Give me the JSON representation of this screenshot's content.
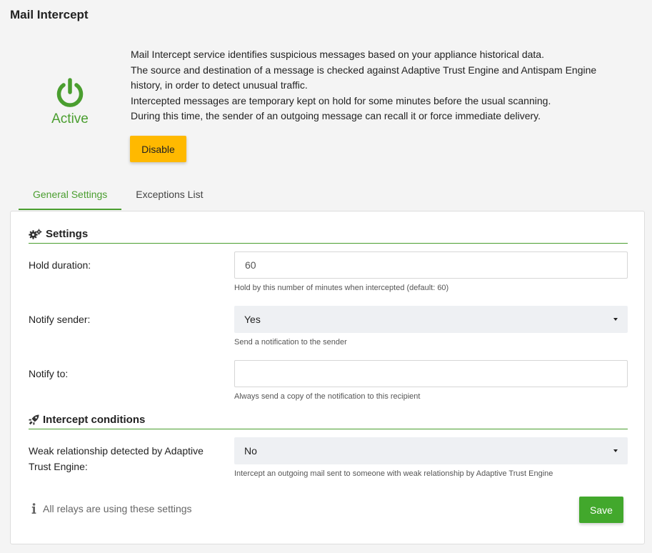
{
  "page": {
    "title": "Mail Intercept"
  },
  "status": {
    "label": "Active",
    "icon": "power-icon",
    "color": "#4a9e2f"
  },
  "description": {
    "lines": [
      "Mail Intercept service identifies suspicious messages based on your appliance historical data.",
      "The source and destination of a message is checked against Adaptive Trust Engine and Antispam Engine",
      "history, in order to detect unusual traffic.",
      "Intercepted messages are temporary kept on hold for some minutes before the usual scanning.",
      "During this time, the sender of an outgoing message can recall it or force immediate delivery."
    ]
  },
  "actions": {
    "disable_label": "Disable",
    "disable_color": "#ffb900"
  },
  "tabs": [
    {
      "label": "General Settings",
      "active": true
    },
    {
      "label": "Exceptions List",
      "active": false
    }
  ],
  "settings": {
    "heading": "Settings",
    "icon": "gears-icon",
    "hold_duration": {
      "label": "Hold duration:",
      "value": "60",
      "help": "Hold by this number of minutes when intercepted (default: 60)"
    },
    "notify_sender": {
      "label": "Notify sender:",
      "value": "Yes",
      "help": "Send a notification to the sender"
    },
    "notify_to": {
      "label": "Notify to:",
      "value": "",
      "help": "Always send a copy of the notification to this recipient"
    }
  },
  "conditions": {
    "heading": "Intercept conditions",
    "icon": "rocket-icon",
    "weak_relationship": {
      "label": "Weak relationship detected by Adaptive Trust Engine:",
      "value": "No",
      "help": "Intercept an outgoing mail sent to someone with weak relationship by Adaptive Trust Engine"
    }
  },
  "footer": {
    "relay_note": "All relays are using these settings",
    "relay_icon": "info-icon",
    "save_label": "Save",
    "save_color": "#42a82c"
  }
}
